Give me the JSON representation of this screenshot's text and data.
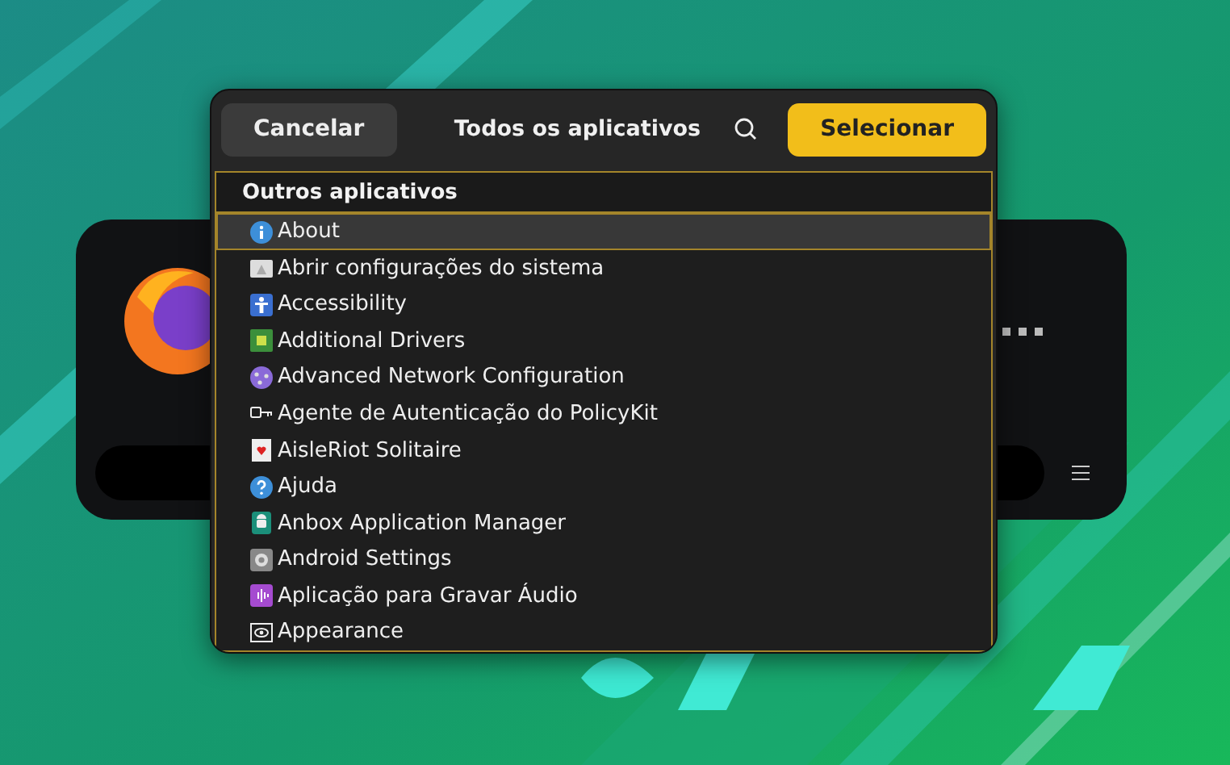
{
  "dialog": {
    "cancel_button": "Cancelar",
    "title": "Todos os aplicativos",
    "select_button": "Selecionar"
  },
  "list": {
    "section": "Outros aplicativos",
    "items": [
      {
        "label": "About",
        "selected": true
      },
      {
        "label": "Abrir configurações do sistema",
        "selected": false
      },
      {
        "label": "Accessibility",
        "selected": false
      },
      {
        "label": "Additional Drivers",
        "selected": false
      },
      {
        "label": "Advanced Network Configuration",
        "selected": false
      },
      {
        "label": "Agente de Autenticação do PolicyKit",
        "selected": false
      },
      {
        "label": "AisleRiot Solitaire",
        "selected": false
      },
      {
        "label": "Ajuda",
        "selected": false
      },
      {
        "label": "Anbox Application Manager",
        "selected": false
      },
      {
        "label": "Android Settings",
        "selected": false
      },
      {
        "label": "Aplicação para Gravar Áudio",
        "selected": false
      },
      {
        "label": "Appearance",
        "selected": false
      }
    ]
  }
}
